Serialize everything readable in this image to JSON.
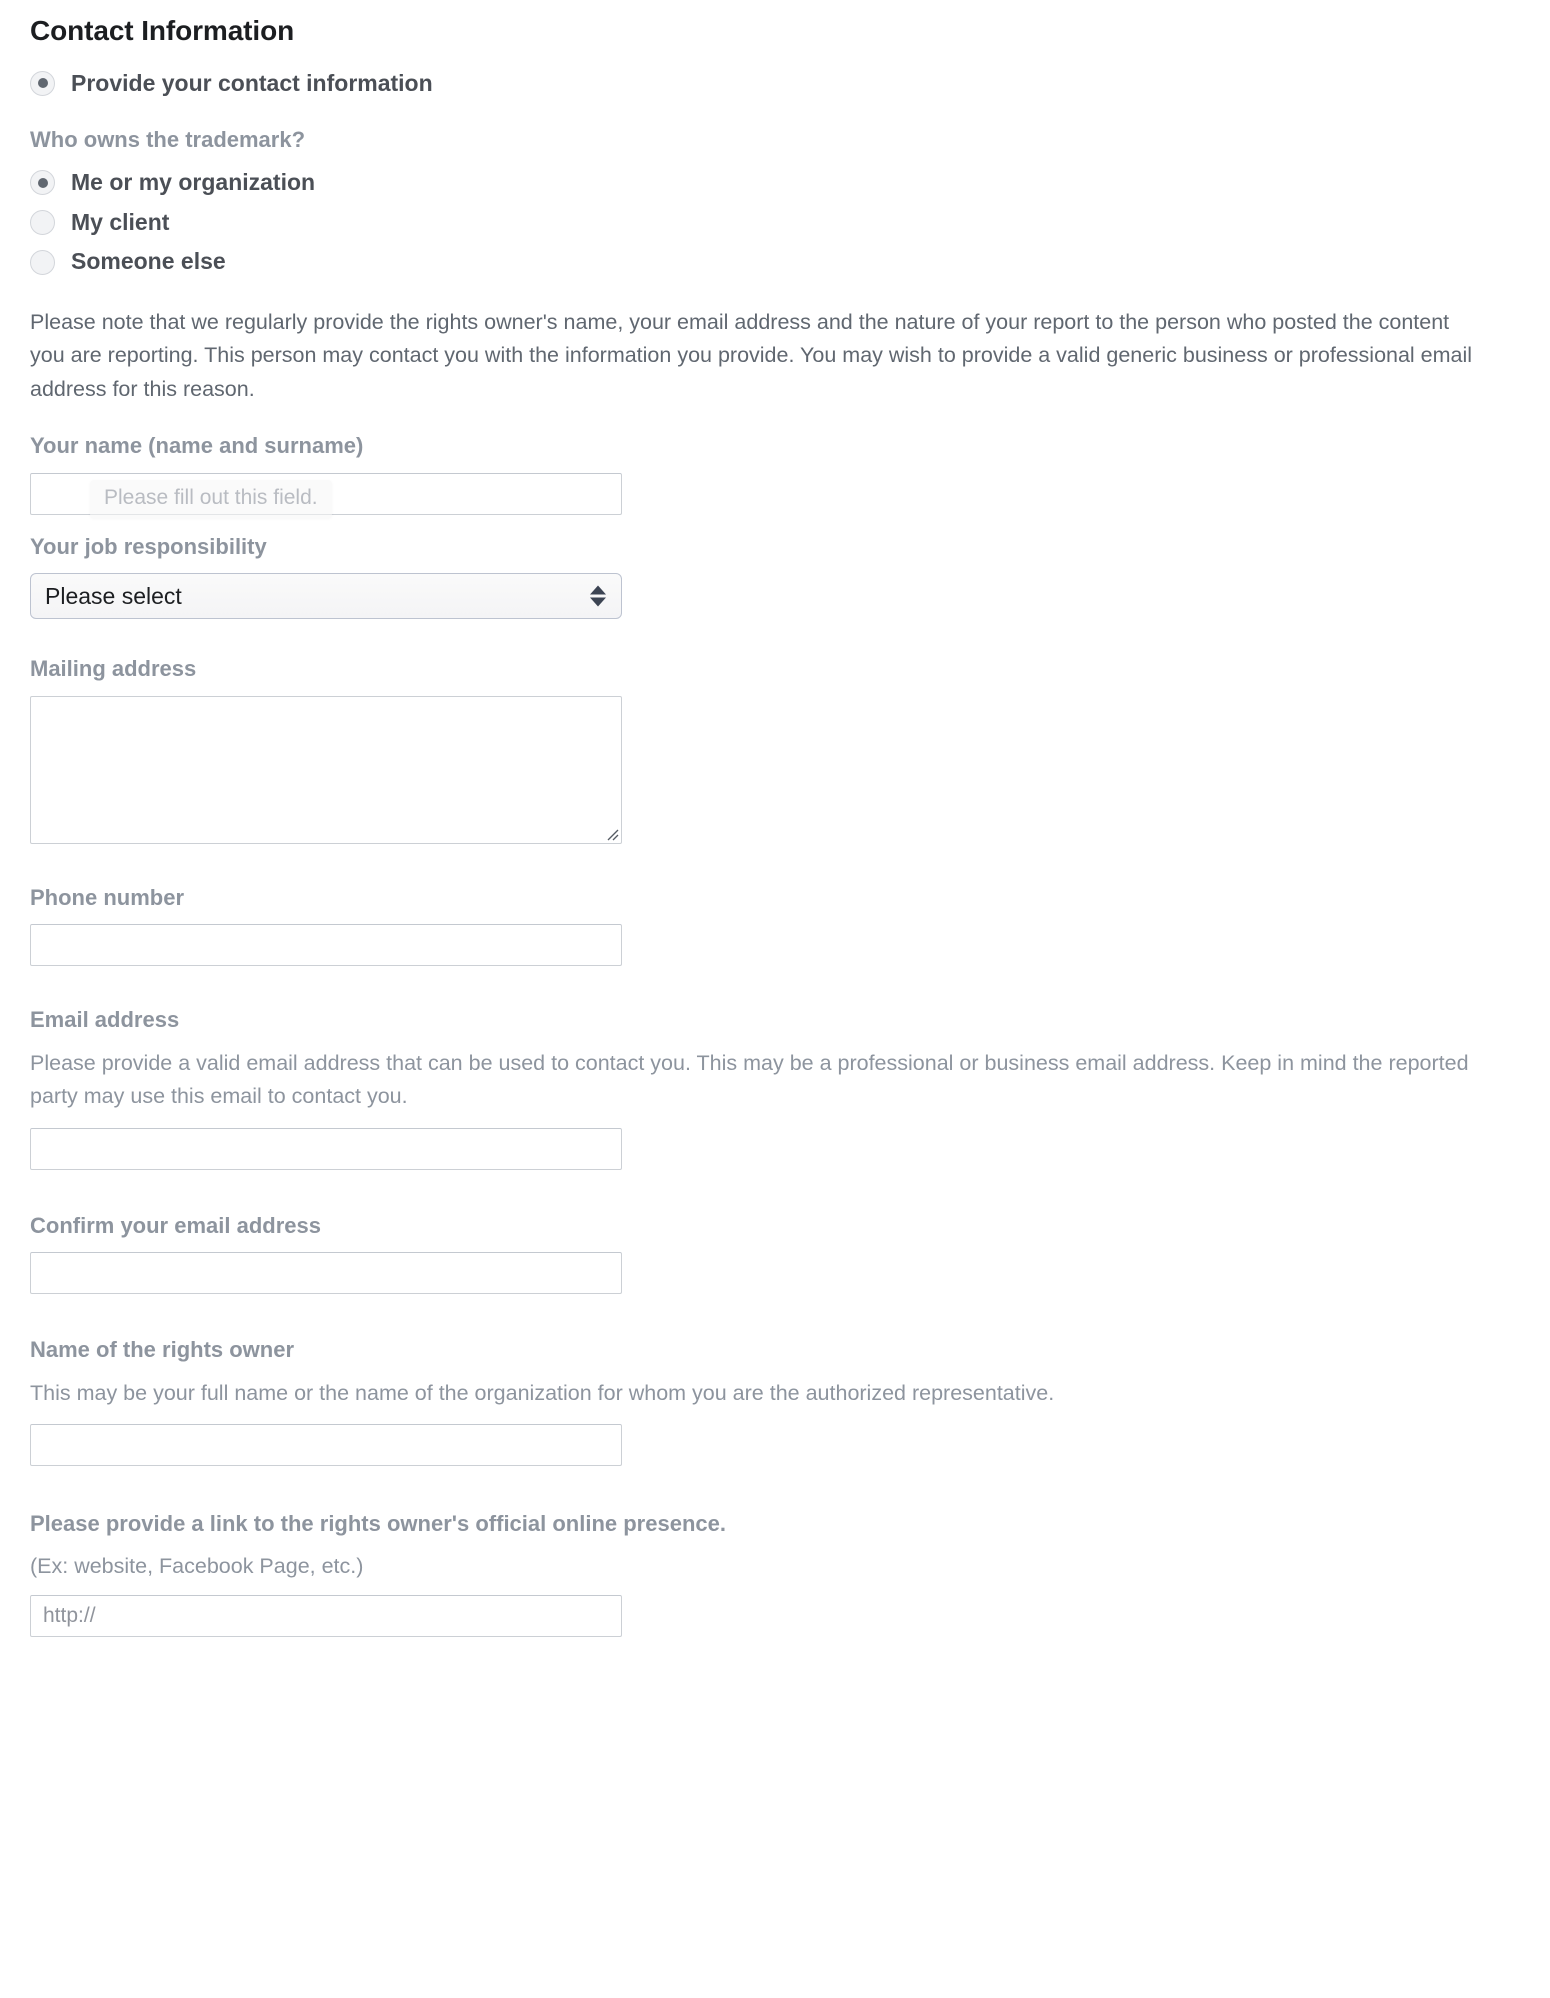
{
  "section": {
    "title": "Contact Information"
  },
  "provide_contact": {
    "label": "Provide your contact information",
    "checked": true
  },
  "owner_question": {
    "label": "Who owns the trademark?",
    "options": [
      {
        "label": "Me or my organization",
        "checked": true
      },
      {
        "label": "My client",
        "checked": false
      },
      {
        "label": "Someone else",
        "checked": false
      }
    ]
  },
  "notice": {
    "text": "Please note that we regularly provide the rights owner's name, your email address and the nature of your report to the person who posted the content you are reporting. This person may contact you with the information you provide. You may wish to provide a valid generic business or professional email address for this reason."
  },
  "fields": {
    "your_name": {
      "label": "Your name (name and surname)",
      "value": "",
      "placeholder": ""
    },
    "validation_tooltip": "Please fill out this field.",
    "job_responsibility": {
      "label": "Your job responsibility",
      "selected": "Please select"
    },
    "mailing_address": {
      "label": "Mailing address",
      "value": "",
      "placeholder": ""
    },
    "phone_number": {
      "label": "Phone number",
      "value": "",
      "placeholder": ""
    },
    "email_address": {
      "label": "Email address",
      "help": "Please provide a valid email address that can be used to contact you. This may be a professional or business email address. Keep in mind the reported party may use this email to contact you.",
      "value": "",
      "placeholder": ""
    },
    "confirm_email": {
      "label": "Confirm your email address",
      "value": "",
      "placeholder": ""
    },
    "rights_owner_name": {
      "label": "Name of the rights owner",
      "help": "This may be your full name or the name of the organization for whom you are the authorized representative.",
      "value": "",
      "placeholder": ""
    },
    "online_presence": {
      "label": "Please provide a link to the rights owner's official online presence.",
      "help": "(Ex: website, Facebook Page, etc.)",
      "value": "",
      "placeholder": "http://"
    }
  },
  "colors": {
    "heading": "#1c1e21",
    "label": "#8d949e",
    "body": "#606770",
    "radio_label": "#4b4f56",
    "input_border": "#ccd0d5",
    "select_border": "#bdc3d0"
  }
}
